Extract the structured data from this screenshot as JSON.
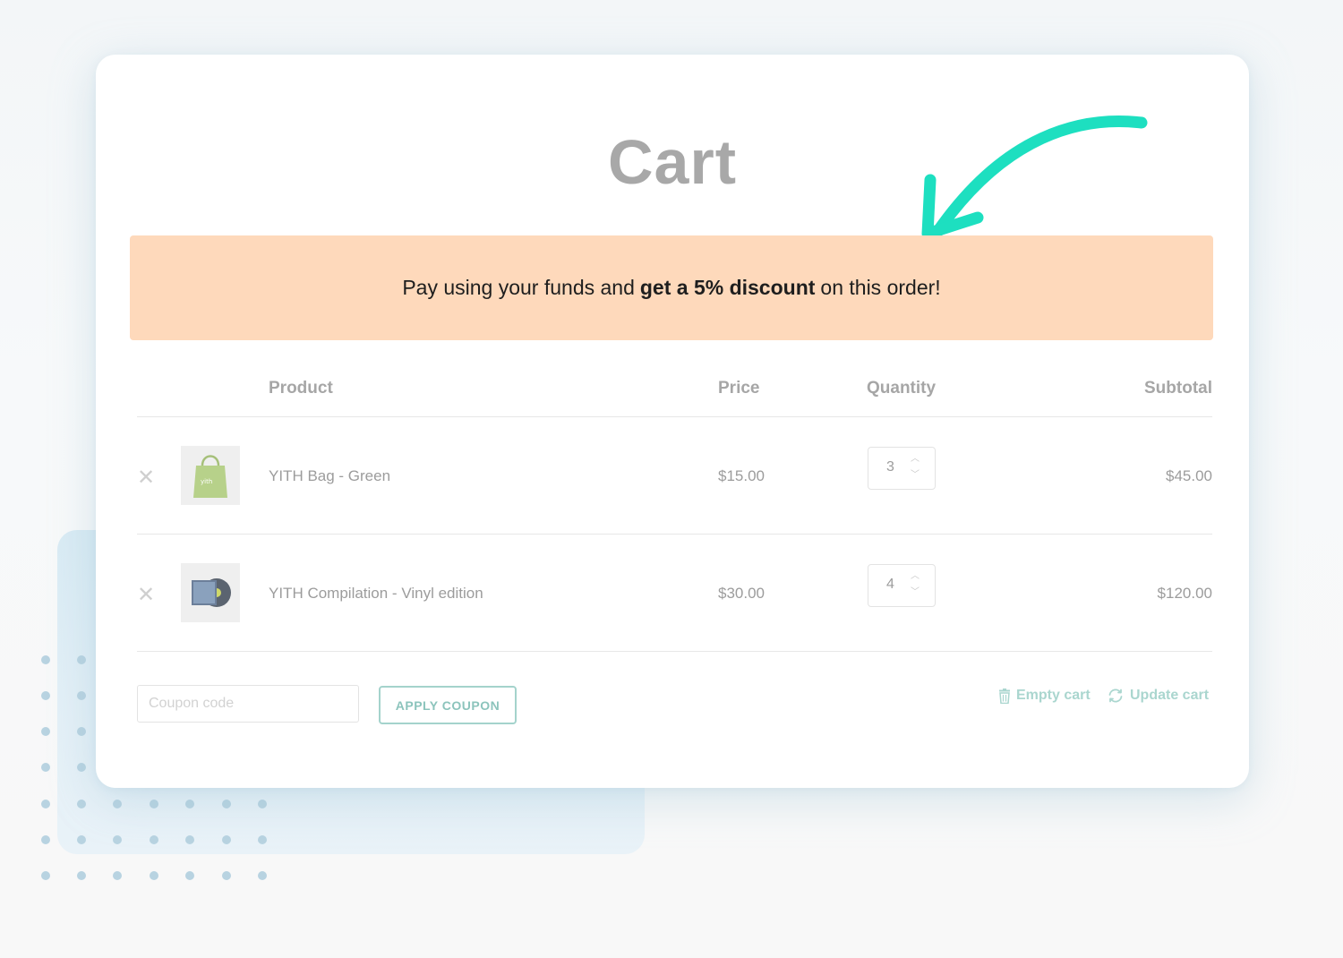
{
  "page": {
    "title": "Cart"
  },
  "notice": {
    "text_before": "Pay using your funds and",
    "text_bold": "get a 5% discount",
    "text_after": "on this order!"
  },
  "table": {
    "headers": {
      "product": "Product",
      "price": "Price",
      "quantity": "Quantity",
      "subtotal": "Subtotal"
    },
    "rows": [
      {
        "name": "YITH Bag - Green",
        "price": "$15.00",
        "quantity": "3",
        "subtotal": "$45.00",
        "thumb_icon": "green-tote-bag"
      },
      {
        "name": "YITH Compilation - Vinyl edition",
        "price": "$30.00",
        "quantity": "4",
        "subtotal": "$120.00",
        "thumb_icon": "vinyl-record"
      }
    ]
  },
  "coupon": {
    "placeholder": "Coupon code",
    "apply_label": "APPLY COUPON"
  },
  "actions": {
    "empty_cart": "Empty cart",
    "update_cart": "Update cart"
  },
  "colors": {
    "notice_bg": "#fed9bb",
    "accent_arrow": "#1ddfc0",
    "accent_button": "#8cc4bc",
    "title": "#a8a8a8"
  }
}
